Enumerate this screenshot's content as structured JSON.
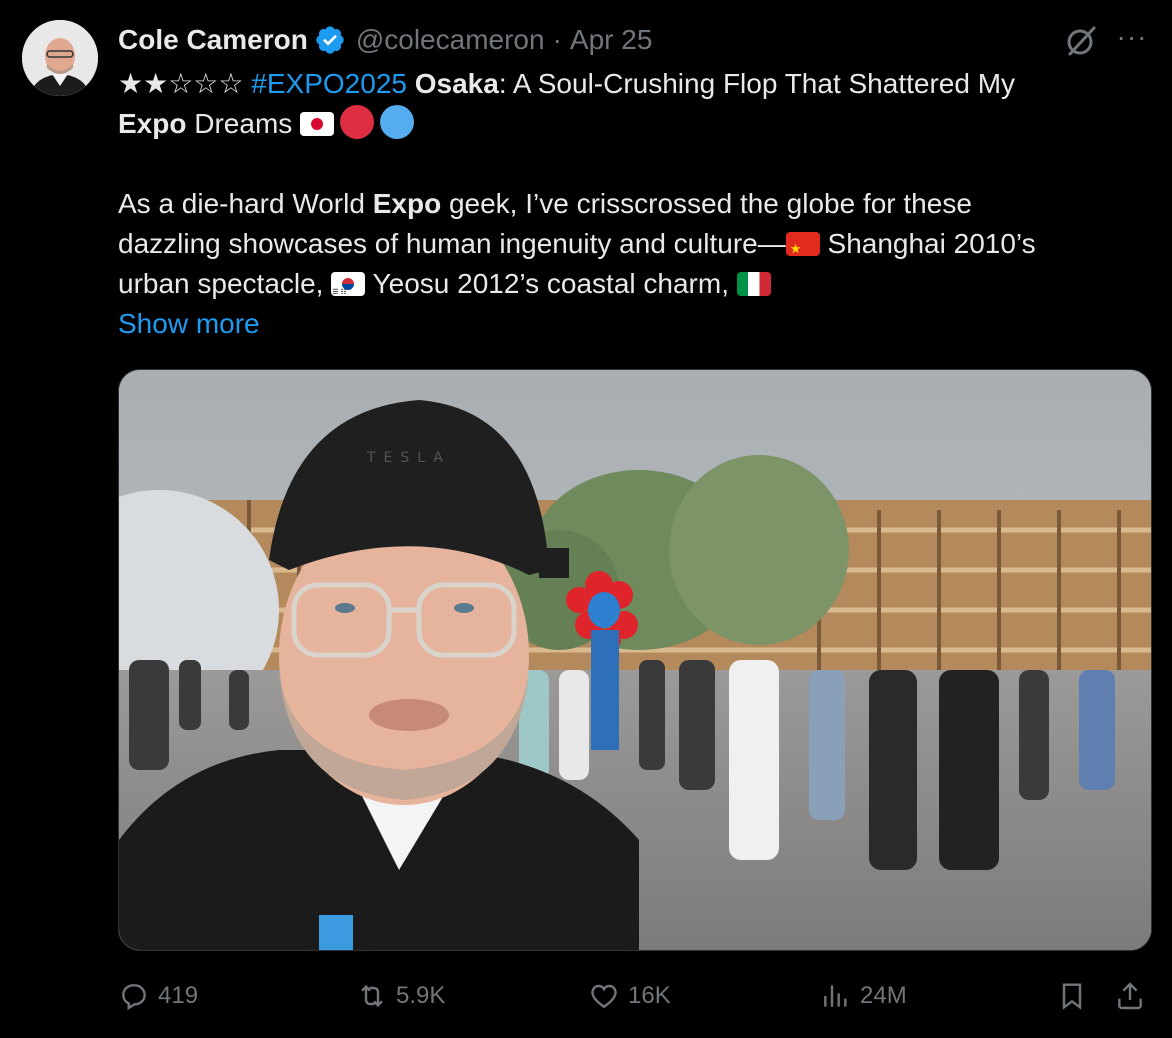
{
  "author": {
    "name": "Cole Cameron",
    "handle": "@colecameron",
    "separator": "·",
    "date": "Apr 25",
    "verified": true
  },
  "post": {
    "stars": "★★☆☆☆",
    "hashtag": "#EXPO2025",
    "title_bold": "Osaka",
    "title_rest": ": A Soul-Crushing Flop That Shattered My",
    "line2_bold": "Expo",
    "line2_rest": " Dreams ",
    "line3_a": "As a die-hard World ",
    "line3_bold": "Expo",
    "line3_b": " geek, I’ve crisscrossed the globe for these",
    "line4_a": "dazzling showcases of human ingenuity and culture—",
    "line4_b": " Shanghai 2010’s",
    "line5_a": "urban spectacle, ",
    "line5_b": " Yeosu 2012’s coastal charm, ",
    "show_more": "Show more",
    "flags": [
      "japan-flag",
      "china-flag",
      "south-korea-flag",
      "italy-flag"
    ],
    "emoji_circles": [
      "#dd2e44",
      "#55acee"
    ]
  },
  "media": {
    "cap_text": "TESLA"
  },
  "actions": {
    "replies": "419",
    "reposts": "5.9K",
    "likes": "16K",
    "views": "24M"
  },
  "colors": {
    "background": "#000000",
    "text": "#e7e9ea",
    "secondary": "#71767b",
    "link": "#1d9bf0",
    "verified": "#1d9bf0"
  }
}
